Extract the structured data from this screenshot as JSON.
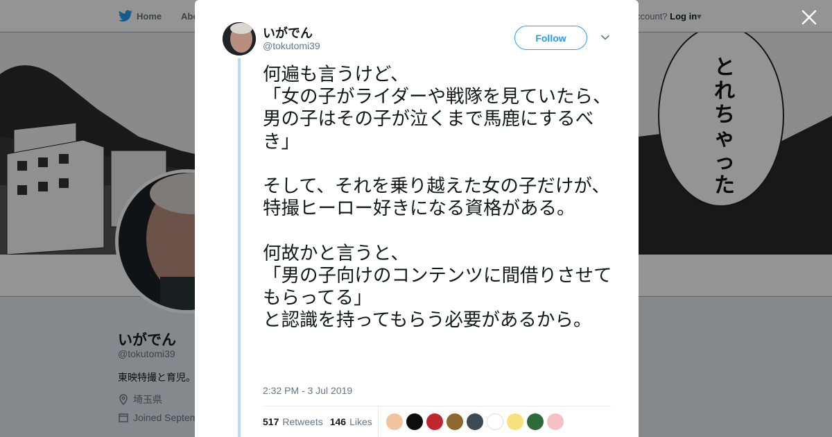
{
  "background": {
    "nav": {
      "home": "Home",
      "about": "Abo",
      "account_prompt": "ccount?",
      "login": "Log in"
    },
    "banner_bubble_text": "とれちゃった",
    "profile": {
      "name": "いがでん",
      "handle": "@tokutomi39",
      "bio": "東映特撮と育児。",
      "location": "埼玉県",
      "joined": "Joined Septem"
    }
  },
  "tweet": {
    "author_name": "いがでん",
    "author_handle": "@tokutomi39",
    "follow_label": "Follow",
    "text": "何遍も言うけど、\n「女の子がライダーや戦隊を見ていたら、男の子はその子が泣くまで馬鹿にするべき」\n\nそして、それを乗り越えた女の子だけが、特撮ヒーロー好きになる資格がある。\n\n何故かと言うと、\n「男の子向けのコンテンツに間借りさせてもらってる」\nと認識を持ってもらう必要があるから。",
    "timestamp": "2:32 PM - 3 Jul 2019",
    "retweets_count": "517",
    "retweets_label": "Retweets",
    "likes_count": "146",
    "likes_label": "Likes"
  },
  "likers": [
    {
      "color": "#f2c3a0"
    },
    {
      "color": "#0d0d0d"
    },
    {
      "color": "#c0262d"
    },
    {
      "color": "#8a6b2d"
    },
    {
      "color": "#3c4a56"
    },
    {
      "color": "#ffffff"
    },
    {
      "color": "#f6e27a"
    },
    {
      "color": "#2e6b3a"
    },
    {
      "color": "#f4c1c9"
    }
  ],
  "colors": {
    "accent": "#1da1f2",
    "thread_line": "#b7dcf2"
  }
}
